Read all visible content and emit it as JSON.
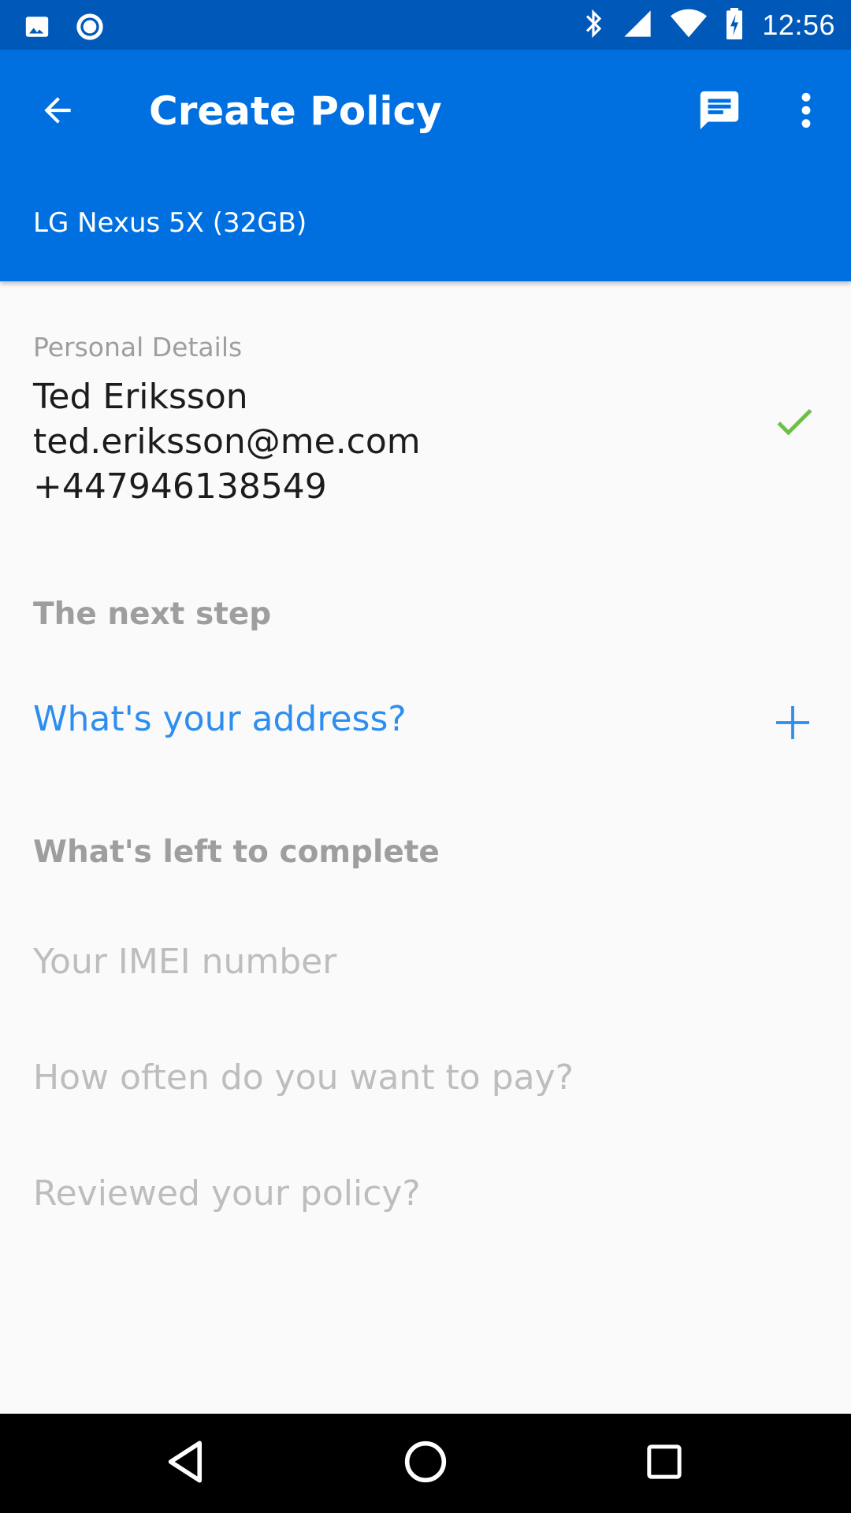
{
  "status_bar": {
    "time": "12:56",
    "icons": [
      "image-icon",
      "record-icon",
      "bluetooth-icon",
      "signal-icon",
      "wifi-icon",
      "battery-charging-icon"
    ]
  },
  "app_bar": {
    "title": "Create Policy",
    "subtitle": "LG Nexus 5X (32GB)",
    "background_color": "#0070e0",
    "icons": [
      "back-arrow-icon",
      "chat-icon",
      "more-vert-icon"
    ]
  },
  "personal_details": {
    "caption": "Personal Details",
    "name": "Ted Eriksson",
    "email": "ted.eriksson@me.com",
    "phone": "+447946138549",
    "status_icon": "check-icon",
    "status_color": "#6cc04a"
  },
  "next_step": {
    "heading": "The next step",
    "item": "What's your address?",
    "action_icon": "plus-icon",
    "accent_color": "#2d8ef0"
  },
  "left_to_complete": {
    "heading": "What's left to complete",
    "items": [
      "Your IMEI number",
      "How often do you want to pay?",
      "Reviewed your policy?"
    ]
  },
  "nav_bar": {
    "icons": [
      "nav-back-icon",
      "nav-home-icon",
      "nav-recents-icon"
    ]
  }
}
